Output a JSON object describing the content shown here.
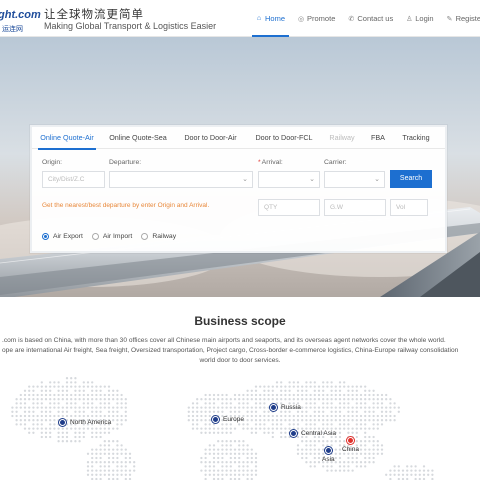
{
  "header": {
    "logo_main": "ght.com",
    "logo_sub": "运连网",
    "slogan_cn": "让全球物流更简单",
    "slogan_en": "Making Global Transport & Logistics Easier",
    "nav": [
      {
        "label": "Home",
        "icon": "home-icon",
        "active": true
      },
      {
        "label": "Promote",
        "icon": "promote-icon",
        "active": false
      },
      {
        "label": "Contact us",
        "icon": "phone-icon",
        "active": false
      },
      {
        "label": "Login",
        "icon": "user-icon",
        "active": false
      },
      {
        "label": "Registe",
        "icon": "register-icon",
        "active": false
      }
    ]
  },
  "quote": {
    "tabs": [
      {
        "label": "Online Quote-Air",
        "state": "active"
      },
      {
        "label": "Online Quote-Sea",
        "state": "normal"
      },
      {
        "label": "Door to Door-Air",
        "state": "normal"
      },
      {
        "label": "Door to Door-FCL",
        "state": "normal"
      },
      {
        "label": "Railway",
        "state": "disabled"
      },
      {
        "label": "FBA",
        "state": "normal"
      },
      {
        "label": "Tracking",
        "state": "normal"
      }
    ],
    "origin_label": "Origin:",
    "origin_placeholder": "City/Dist/Z.C",
    "departure_label": "Departure:",
    "arrival_label": "Arrival:",
    "arrival_required_mark": "*",
    "carrier_label": "Carrier:",
    "search_label": "Search",
    "hint": "Get the nearest/best departure by enter Origin and Arrival.",
    "qty_placeholder": "QTY",
    "gw_placeholder": "G.W",
    "vol_placeholder": "Vol",
    "radios": [
      {
        "label": "Air Export",
        "checked": true
      },
      {
        "label": "Air Import",
        "checked": false
      },
      {
        "label": "Railway",
        "checked": false
      }
    ]
  },
  "business": {
    "title": "Business scope",
    "line1": ".com is based on China, with more than 30 offices cover all Chinese main airports and seaports, and its overseas agent networks cover the whole world.",
    "line2": "ope are international Air freight, Sea freight, Oversized transportation, Project cargo, Cross-border e-commerce logistics, China-Europe railway consolidation",
    "line3": "world door to door services."
  },
  "map": {
    "regions": [
      {
        "label": "North America",
        "marker": "blue"
      },
      {
        "label": "Europe",
        "marker": "blue"
      },
      {
        "label": "Russia",
        "marker": "blue"
      },
      {
        "label": "Central Asia",
        "marker": "blue"
      },
      {
        "label": "China",
        "marker": "red"
      },
      {
        "label": "Asia",
        "marker": "blue"
      }
    ],
    "colors": {
      "blue": "#1f3d8a",
      "red": "#e0302b",
      "accent": "#1d6fd0"
    }
  }
}
